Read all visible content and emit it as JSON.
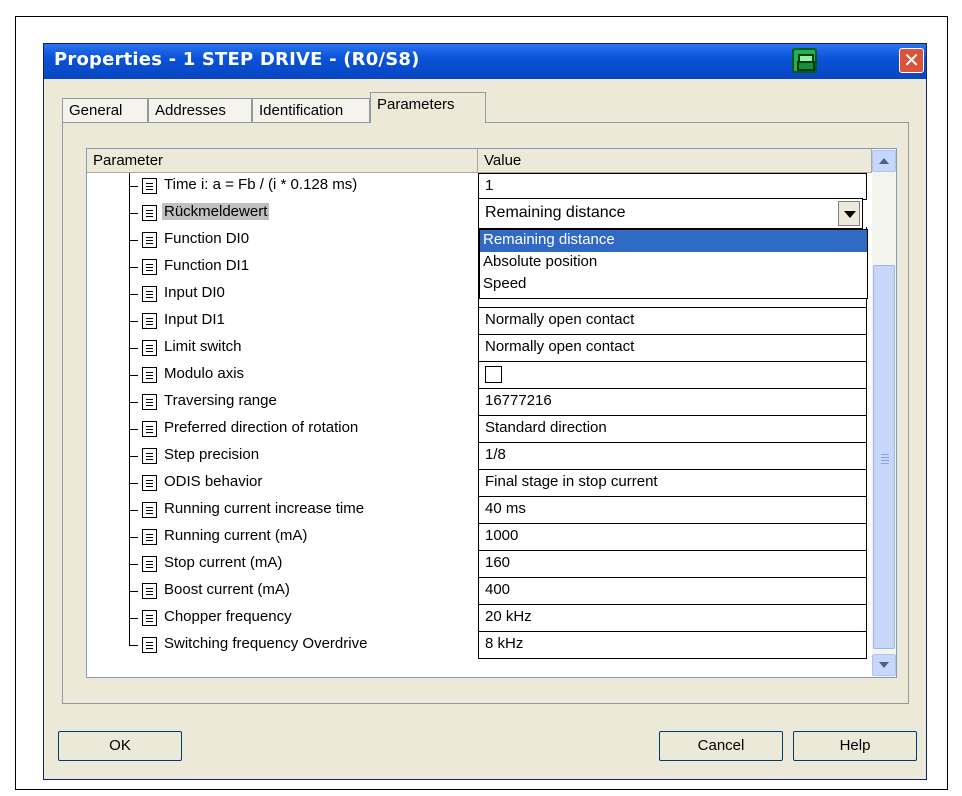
{
  "window": {
    "title": "Properties - 1 STEP DRIVE - (R0/S8)"
  },
  "tabs": [
    {
      "label": "General"
    },
    {
      "label": "Addresses"
    },
    {
      "label": "Identification"
    },
    {
      "label": "Parameters",
      "active": true
    }
  ],
  "table": {
    "headers": {
      "parameter": "Parameter",
      "value": "Value"
    },
    "rows": [
      {
        "name": "Time i: a = Fb / (i * 0.128 ms)",
        "value": "1"
      },
      {
        "name": "Rückmeldewert",
        "value": "Remaining distance",
        "selected": true
      },
      {
        "name": "Function DI0",
        "value": ""
      },
      {
        "name": "Function DI1",
        "value": ""
      },
      {
        "name": "Input DI0",
        "value": ""
      },
      {
        "name": "Input DI1",
        "value": "Normally open contact"
      },
      {
        "name": "Limit switch",
        "value": "Normally open contact"
      },
      {
        "name": "Modulo axis",
        "value": "",
        "checked": false
      },
      {
        "name": "Traversing range",
        "value": "16777216"
      },
      {
        "name": "Preferred direction of rotation",
        "value": "Standard direction"
      },
      {
        "name": "Step precision",
        "value": "1/8"
      },
      {
        "name": "ODIS behavior",
        "value": "Final stage in stop current"
      },
      {
        "name": "Running current increase time",
        "value": "40 ms"
      },
      {
        "name": "Running current (mA)",
        "value": "1000"
      },
      {
        "name": "Stop current (mA)",
        "value": "160"
      },
      {
        "name": "Boost current (mA)",
        "value": "400"
      },
      {
        "name": "Chopper frequency",
        "value": "20 kHz"
      },
      {
        "name": "Switching frequency Overdrive",
        "value": "8 kHz"
      }
    ]
  },
  "dropdown": {
    "options": [
      "Remaining distance",
      "Absolute position",
      "Speed"
    ],
    "highlighted": "Remaining distance"
  },
  "buttons": {
    "ok": "OK",
    "cancel": "Cancel",
    "help": "Help"
  },
  "colors": {
    "titlebar": "#0a52d8",
    "highlight": "#316ac5",
    "face": "#ece9d8"
  }
}
